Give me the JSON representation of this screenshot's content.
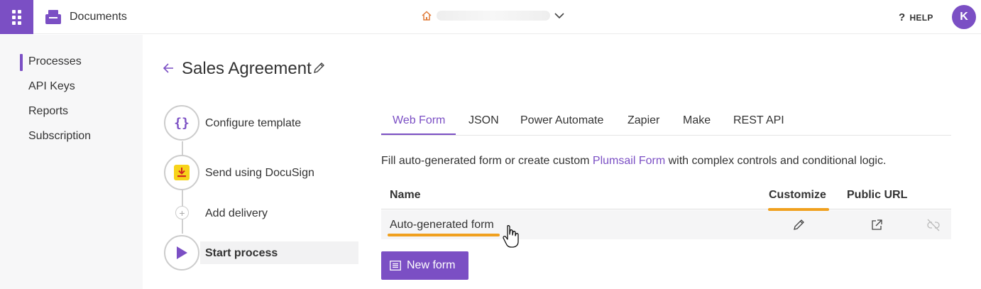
{
  "header": {
    "app_title": "Documents",
    "help_label": "HELP",
    "avatar_initial": "K"
  },
  "sidebar": {
    "items": [
      {
        "label": "Processes",
        "active": true
      },
      {
        "label": "API Keys",
        "active": false
      },
      {
        "label": "Reports",
        "active": false
      },
      {
        "label": "Subscription",
        "active": false
      }
    ]
  },
  "page": {
    "title": "Sales Agreement"
  },
  "steps": [
    {
      "label": "Configure template",
      "icon": "braces-icon"
    },
    {
      "label": "Send using DocuSign",
      "icon": "docusign-icon"
    },
    {
      "label": "Add delivery",
      "icon": "plus-icon"
    },
    {
      "label": "Start process",
      "icon": "play-icon",
      "active": true
    }
  ],
  "tabs": [
    {
      "label": "Web Form",
      "active": true
    },
    {
      "label": "JSON"
    },
    {
      "label": "Power Automate"
    },
    {
      "label": "Zapier"
    },
    {
      "label": "Make"
    },
    {
      "label": "REST API"
    }
  ],
  "description": {
    "before": "Fill auto-generated form or create custom ",
    "link": "Plumsail Form",
    "after": " with complex controls and conditional logic."
  },
  "table": {
    "columns": [
      "Name",
      "Customize",
      "Public URL"
    ],
    "rows": [
      {
        "name": "Auto-generated form"
      }
    ]
  },
  "new_form_label": "New form",
  "colors": {
    "accent": "#7b4fc4",
    "highlight": "#f0a01e",
    "home_icon": "#e07b39"
  }
}
